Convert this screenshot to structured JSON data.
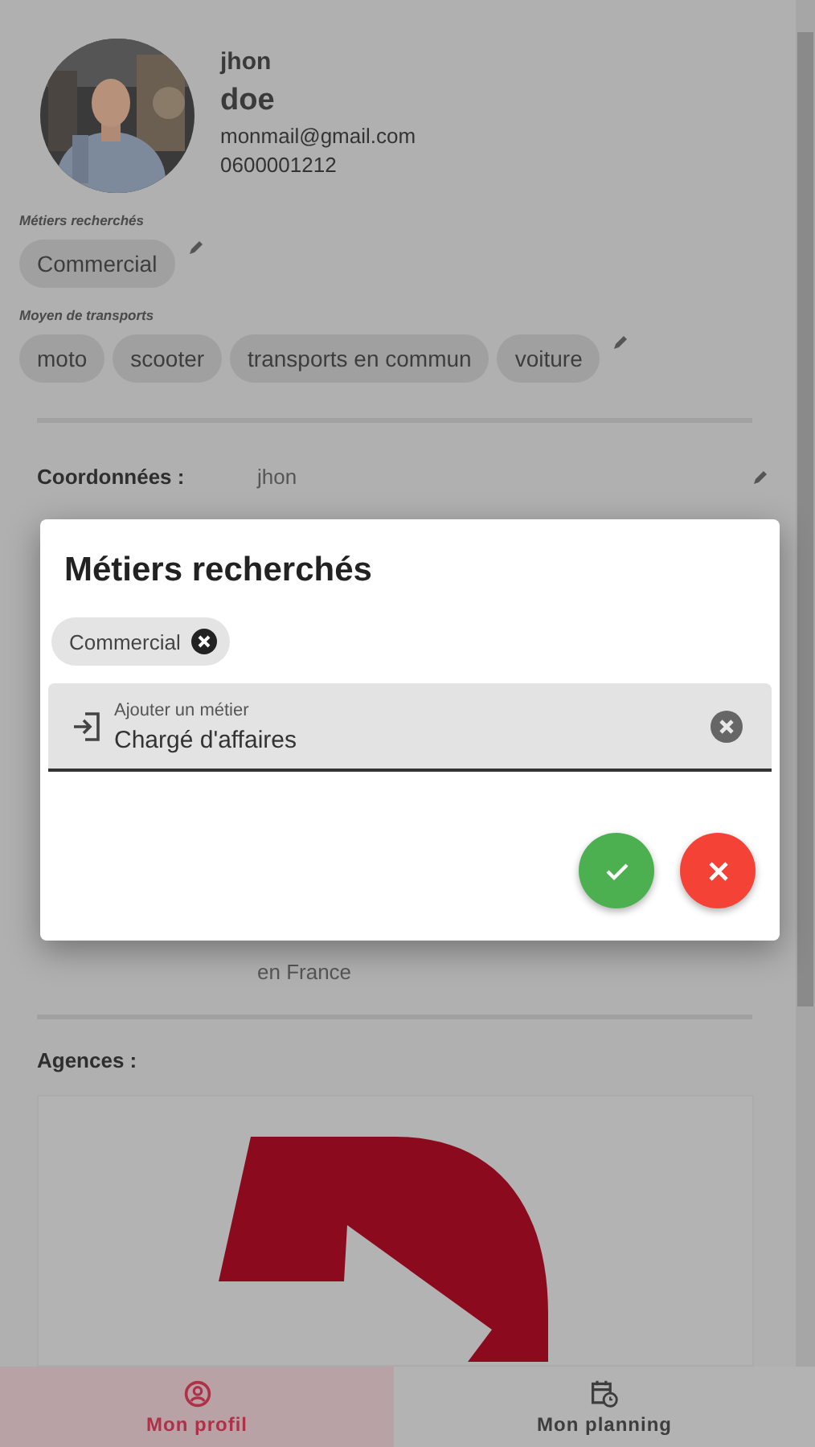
{
  "profile": {
    "first_name": "jhon",
    "last_name": "doe",
    "email": "monmail@gmail.com",
    "phone": "0600001212"
  },
  "jobs": {
    "label": "Métiers recherchés",
    "chips": [
      "Commercial"
    ]
  },
  "transport": {
    "label": "Moyen de transports",
    "chips": [
      "moto",
      "scooter",
      "transports en commun",
      "voiture"
    ]
  },
  "coordinates": {
    "label": "Coordonnées :",
    "value_top": "jhon",
    "value_bottom": "en France"
  },
  "agencies": {
    "label": "Agences :"
  },
  "dialog": {
    "title": "Métiers recherchés",
    "chips": [
      "Commercial"
    ],
    "field": {
      "label": "Ajouter un métier",
      "value": "Chargé d'affaires"
    }
  },
  "nav": [
    {
      "label": "Mon profil",
      "kind": "profile",
      "selected": true
    },
    {
      "label": "Mon planning",
      "kind": "planning",
      "selected": false
    }
  ]
}
